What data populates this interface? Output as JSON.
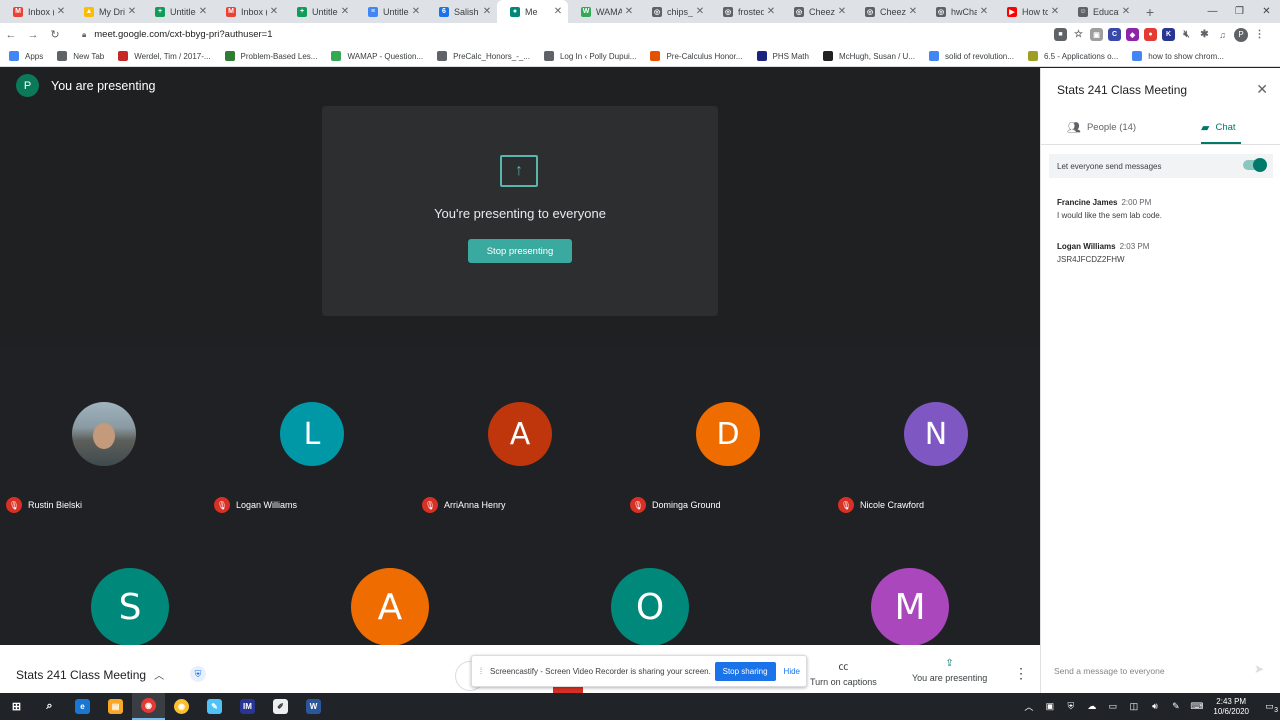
{
  "browser": {
    "tabs": [
      {
        "title": "Inbox (",
        "color": "#ea4335",
        "glyph": "M"
      },
      {
        "title": "My Driv",
        "color": "#fbbc04",
        "glyph": "▲"
      },
      {
        "title": "Untitled",
        "color": "#0f9d58",
        "glyph": "+"
      },
      {
        "title": "Inbox (",
        "color": "#ea4335",
        "glyph": "M"
      },
      {
        "title": "Untitled",
        "color": "#0f9d58",
        "glyph": "+"
      },
      {
        "title": "Untitled",
        "color": "#4285f4",
        "glyph": "≡"
      },
      {
        "title": "Salish K",
        "color": "#1a73e8",
        "glyph": "6"
      },
      {
        "title": "Me",
        "color": "#00897b",
        "glyph": "●",
        "active": true
      },
      {
        "title": "WAMA",
        "color": "#34a853",
        "glyph": "W"
      },
      {
        "title": "chips_a",
        "color": "#5f6368",
        "glyph": "◎"
      },
      {
        "title": "frosted",
        "color": "#5f6368",
        "glyph": "◎"
      },
      {
        "title": "Cheez_",
        "color": "#5f6368",
        "glyph": "◎"
      },
      {
        "title": "Cheez_",
        "color": "#5f6368",
        "glyph": "◎"
      },
      {
        "title": "hwChap",
        "color": "#5f6368",
        "glyph": "◎"
      },
      {
        "title": "How to",
        "color": "#ff0000",
        "glyph": "▶"
      },
      {
        "title": "Educati",
        "color": "#5f6368",
        "glyph": "☺"
      }
    ],
    "new_tab": "+",
    "url": "meet.google.com/cxt-bbyg-pri?authuser=1",
    "profile_initial": "P",
    "bookmarks": [
      {
        "label": "Apps",
        "color": "#4285f4"
      },
      {
        "label": "New Tab",
        "color": "#5f6368"
      },
      {
        "label": "Werdel, Tim / 2017-...",
        "color": "#c62828"
      },
      {
        "label": "Problem-Based Les...",
        "color": "#2e7d32"
      },
      {
        "label": "WAMAP - Question...",
        "color": "#34a853"
      },
      {
        "label": "PreCalc_Honors_-_...",
        "color": "#5f6368"
      },
      {
        "label": "Log In ‹ Polly Dupui...",
        "color": "#5f6368"
      },
      {
        "label": "Pre-Calculus Honor...",
        "color": "#e65100"
      },
      {
        "label": "PHS Math",
        "color": "#1a237e"
      },
      {
        "label": "McHugh, Susan / U...",
        "color": "#212121"
      },
      {
        "label": "solid of revolution...",
        "color": "#4285f4"
      },
      {
        "label": "6.5 - Applications o...",
        "color": "#9e9d24"
      },
      {
        "label": "how to show chrom...",
        "color": "#4285f4"
      }
    ]
  },
  "meet": {
    "presenting_label": "You are presenting",
    "presenter_initial": "P",
    "present_message": "You're presenting to everyone",
    "stop_presenting": "Stop presenting",
    "participants": [
      {
        "name": "Rustin Bielski",
        "initial": "",
        "color": "#6d7f86",
        "photo": true
      },
      {
        "name": "Logan Williams",
        "initial": "L",
        "color": "#0097a7"
      },
      {
        "name": "ArriAnna Henry",
        "initial": "A",
        "color": "#bf360c"
      },
      {
        "name": "Dominga Ground",
        "initial": "D",
        "color": "#ef6c00"
      },
      {
        "name": "Nicole Crawford",
        "initial": "N",
        "color": "#7e57c2"
      }
    ],
    "participants_row2": [
      {
        "initial": "S",
        "color": "#00897b"
      },
      {
        "initial": "A",
        "color": "#ef6c00"
      },
      {
        "initial": "O",
        "color": "#00897b"
      },
      {
        "initial": "M",
        "color": "#ab47bc"
      }
    ],
    "meeting_title": "Stats 241 Class Meeting",
    "captions_label": "Turn on captions",
    "presenting_btn_label": "You are presenting",
    "screencastify": {
      "text": "Screencastify - Screen Video Recorder is sharing your screen.",
      "stop": "Stop sharing",
      "hide": "Hide"
    }
  },
  "panel": {
    "title": "Stats 241 Class Meeting",
    "people_tab": "People (14)",
    "chat_tab": "Chat",
    "setting": "Let everyone send messages",
    "messages": [
      {
        "sender": "Francine James",
        "time": "2:00 PM",
        "body": "I would like the sem lab code."
      },
      {
        "sender": "Logan Williams",
        "time": "2:03 PM",
        "body": "JSR4JFCDZ2FHW"
      }
    ],
    "input_placeholder": "Send a message to everyone"
  },
  "taskbar": {
    "time": "2:43 PM",
    "date": "10/6/2020",
    "notification_count": "3"
  }
}
